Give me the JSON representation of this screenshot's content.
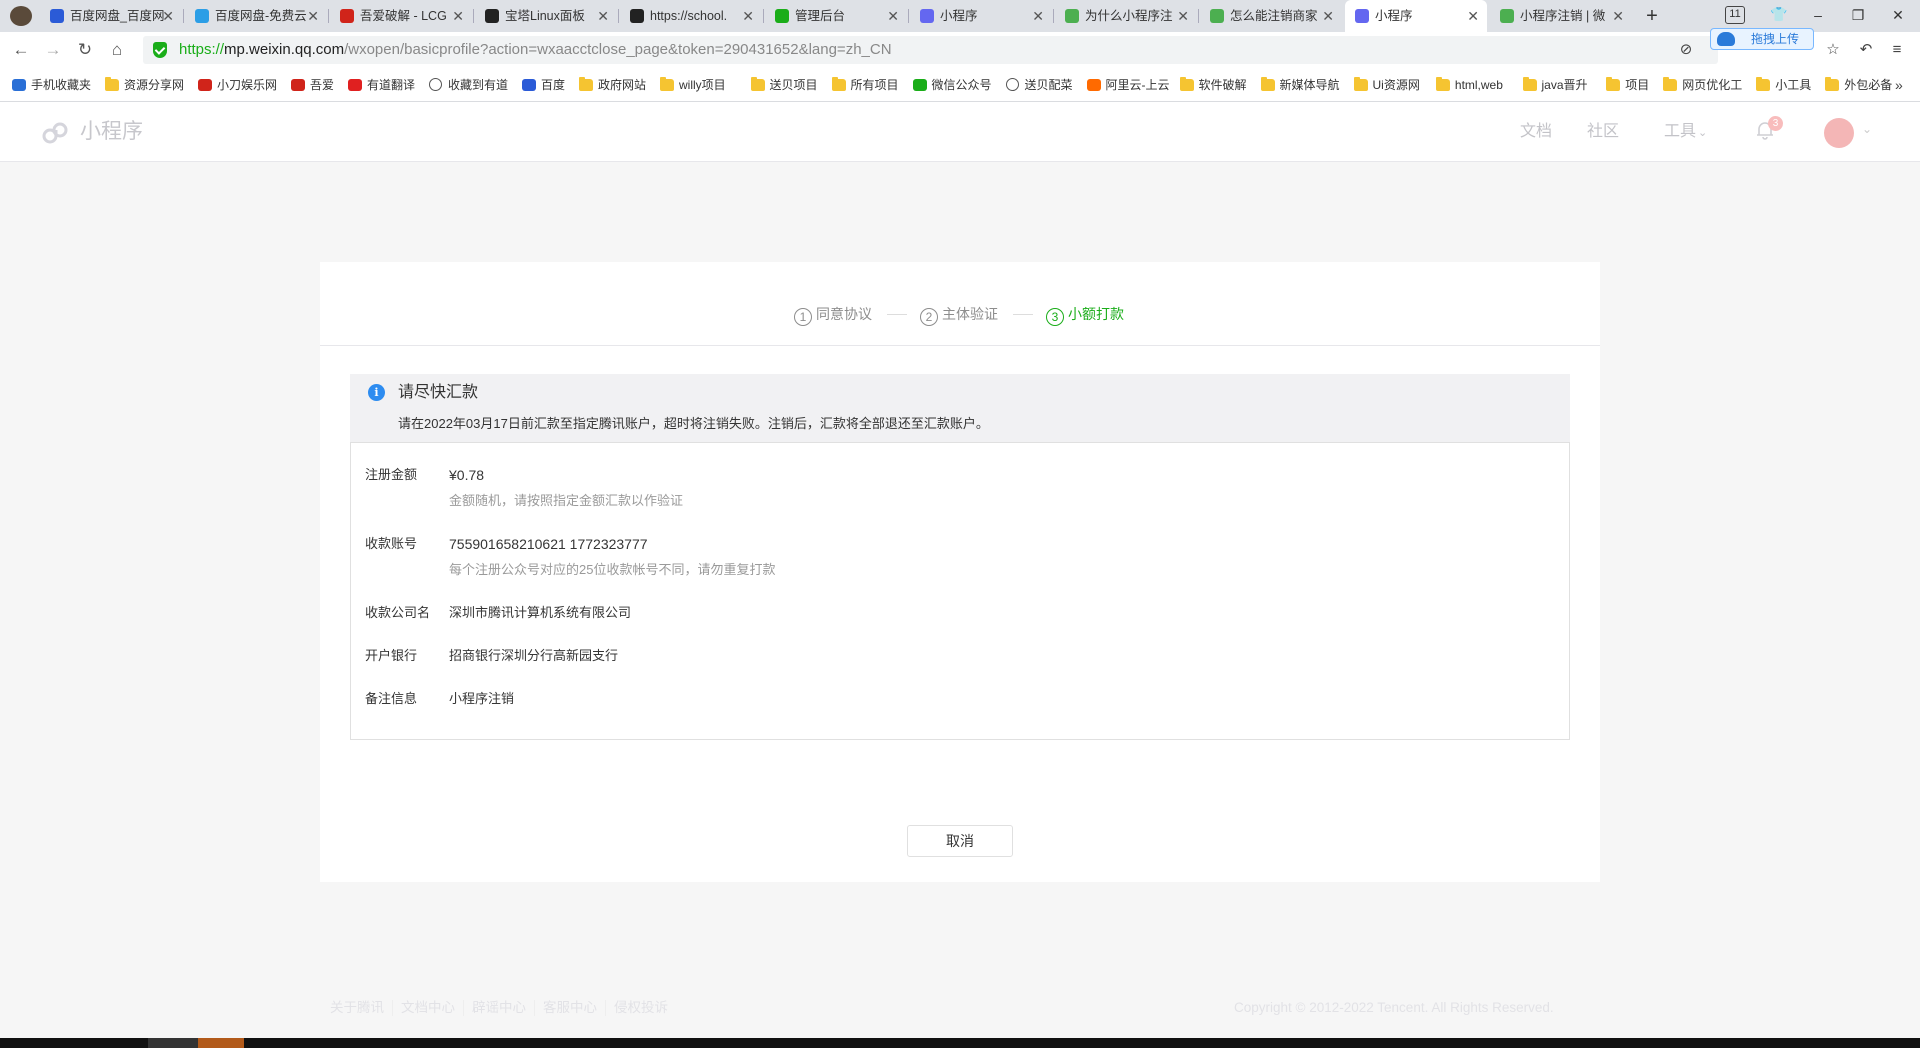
{
  "browser": {
    "tabs": [
      {
        "label": "百度网盘_百度网",
        "color": "#2b5bd7"
      },
      {
        "label": "百度网盘-免费云",
        "color": "#2b9ee6"
      },
      {
        "label": "吾爱破解 - LCG",
        "color": "#d0241a"
      },
      {
        "label": "宝塔Linux面板",
        "color": "#222222"
      },
      {
        "label": "https://school.",
        "color": "#222222"
      },
      {
        "label": "管理后台",
        "color": "#1aad19"
      },
      {
        "label": "小程序",
        "color": "#6467f0"
      },
      {
        "label": "为什么小程序注",
        "color": "#4caf50"
      },
      {
        "label": "怎么能注销商家",
        "color": "#4caf50"
      },
      {
        "label": "小程序",
        "color": "#6467f0"
      },
      {
        "label": "小程序注销 | 微",
        "color": "#4caf50"
      }
    ],
    "active_tab": 9,
    "new_tab_label": "+",
    "tab_count": "11",
    "upload_label": "拖拽上传",
    "url": {
      "protocol": "https://",
      "host": "mp.weixin.qq.com",
      "path": "/wxopen/basicprofile?action=wxaacctclose_page&token=290431652&lang=zh_CN"
    },
    "bookmarks": [
      {
        "label": "手机收藏夹",
        "icon": "phone-icon"
      },
      {
        "label": "资源分享网",
        "icon": "folder-icon"
      },
      {
        "label": "小刀娱乐网",
        "icon": "site-icon"
      },
      {
        "label": "吾爱",
        "icon": "site-icon"
      },
      {
        "label": "有道翻译",
        "icon": "youdao-icon"
      },
      {
        "label": "收藏到有道",
        "icon": "globe-icon"
      },
      {
        "label": "百度",
        "icon": "baidu-icon"
      },
      {
        "label": "政府网站",
        "icon": "folder-icon"
      },
      {
        "label": "willy项目",
        "icon": "folder-icon"
      },
      {
        "label": "送贝项目",
        "icon": "folder-icon"
      },
      {
        "label": "所有项目",
        "icon": "folder-icon"
      },
      {
        "label": "微信公众号",
        "icon": "wechat-icon"
      },
      {
        "label": "送贝配菜",
        "icon": "globe-icon"
      },
      {
        "label": "阿里云-上云",
        "icon": "aliyun-icon"
      },
      {
        "label": "软件破解",
        "icon": "folder-icon"
      },
      {
        "label": "新媒体导航",
        "icon": "folder-icon"
      },
      {
        "label": "Ui资源网",
        "icon": "folder-icon"
      },
      {
        "label": "html,web",
        "icon": "folder-icon"
      },
      {
        "label": "java晋升",
        "icon": "folder-icon"
      },
      {
        "label": "项目",
        "icon": "folder-icon"
      },
      {
        "label": "网页优化工",
        "icon": "folder-icon"
      },
      {
        "label": "小工具",
        "icon": "folder-icon"
      },
      {
        "label": "外包必备",
        "icon": "folder-icon"
      }
    ],
    "bookmarks_more": "»"
  },
  "header": {
    "logo_text": "小程序",
    "nav": [
      "文档",
      "社区",
      "工具"
    ],
    "notification_count": "3"
  },
  "steps": [
    {
      "num": "1",
      "label": "同意协议"
    },
    {
      "num": "2",
      "label": "主体验证"
    },
    {
      "num": "3",
      "label": "小额打款"
    }
  ],
  "notice": {
    "title": "请尽快汇款",
    "desc": "请在2022年03月17日前汇款至指定腾讯账户，超时将注销失败。注销后，汇款将全部退还至汇款账户。"
  },
  "details": [
    {
      "label": "注册金额",
      "value": "¥0.78",
      "hint": "金额随机，请按照指定金额汇款以作验证"
    },
    {
      "label": "收款账号",
      "value": "755901658210621 1772323777",
      "hint": "每个注册公众号对应的25位收款帐号不同，请勿重复打款"
    },
    {
      "label": "收款公司名",
      "value": "深圳市腾讯计算机系统有限公司",
      "hint": ""
    },
    {
      "label": "开户银行",
      "value": "招商银行深圳分行高新园支行",
      "hint": ""
    },
    {
      "label": "备注信息",
      "value": "小程序注销",
      "hint": ""
    }
  ],
  "cancel_label": "取消",
  "footer": {
    "links": [
      "关于腾讯",
      "文档中心",
      "辟谣中心",
      "客服中心",
      "侵权投诉"
    ],
    "copyright": "Copyright © 2012-2022 Tencent. All Rights Reserved."
  },
  "colors": {
    "accent": "#1aad19",
    "info": "#2d8cf0"
  }
}
